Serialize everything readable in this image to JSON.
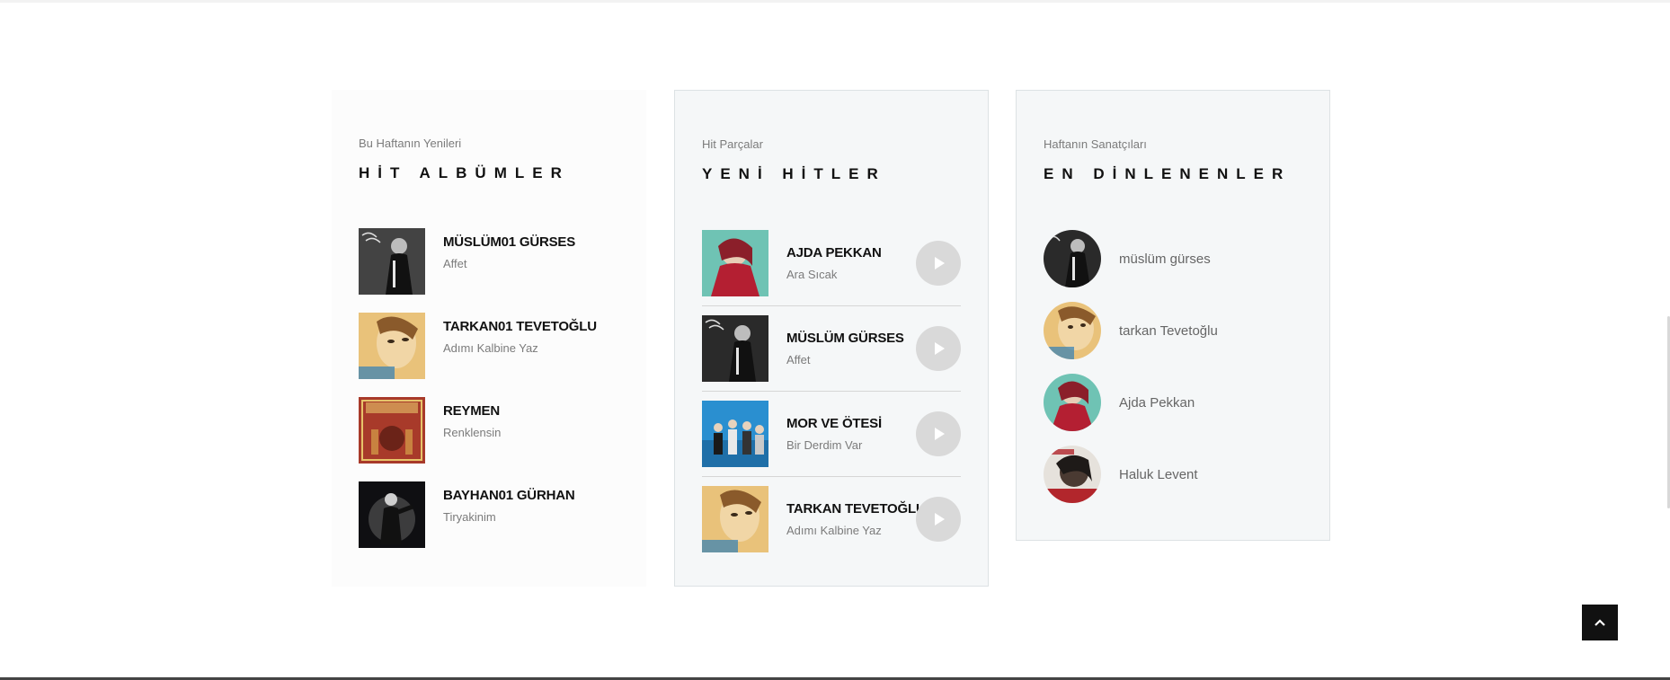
{
  "albums_section": {
    "subtitle": "Bu Haftanın Yenileri",
    "title": "HİT ALBÜMLER",
    "items": [
      {
        "artist": "MÜSLÜM01 GÜRSES",
        "album": "Affet"
      },
      {
        "artist": "TARKAN01 TEVETOĞLU",
        "album": "Adımı Kalbine Yaz"
      },
      {
        "artist": "REYMEN",
        "album": "Renklensin"
      },
      {
        "artist": "BAYHAN01 GÜRHAN",
        "album": "Tiryakinim"
      }
    ]
  },
  "tracks_section": {
    "subtitle": "Hit Parçalar",
    "title": "YENİ HİTLER",
    "items": [
      {
        "artist": "AJDA PEKKAN",
        "track": "Ara Sıcak"
      },
      {
        "artist": "MÜSLÜM GÜRSES",
        "track": "Affet"
      },
      {
        "artist": "MOR VE ÖTESİ",
        "track": "Bir Derdim Var"
      },
      {
        "artist": "TARKAN TEVETOĞLU",
        "track": "Adımı Kalbine Yaz"
      }
    ]
  },
  "artists_section": {
    "subtitle": "Haftanın Sanatçıları",
    "title": "EN DİNLENENLER",
    "items": [
      {
        "name": "müslüm gürses"
      },
      {
        "name": "tarkan Tevetoğlu"
      },
      {
        "name": "Ajda Pekkan"
      },
      {
        "name": "Haluk Levent"
      }
    ]
  },
  "icons": {
    "play": "play-icon",
    "back_to_top": "chevron-up-icon"
  },
  "colors": {
    "card_bg": "#f5f7f8",
    "play_button": "#d9d9d9",
    "back_to_top_bg": "#111111"
  }
}
